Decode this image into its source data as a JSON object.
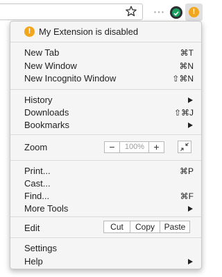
{
  "toolbar": {
    "bookmark_icon": "star-icon",
    "extension_icons": [
      "dots-icon",
      "green-check-extension-icon",
      "warning-extension-icon"
    ],
    "warning_glyph": "!"
  },
  "menu": {
    "warning": {
      "icon": "warning-icon",
      "glyph": "!",
      "label": "My Extension is disabled",
      "color": "#f2a61c"
    },
    "new_tab": {
      "label": "New Tab",
      "shortcut": "⌘T"
    },
    "new_window": {
      "label": "New Window",
      "shortcut": "⌘N"
    },
    "new_incognito": {
      "label": "New Incognito Window",
      "shortcut": "⇧⌘N"
    },
    "history": {
      "label": "History",
      "submenu": true
    },
    "downloads": {
      "label": "Downloads",
      "shortcut": "⇧⌘J"
    },
    "bookmarks": {
      "label": "Bookmarks",
      "submenu": true
    },
    "zoom": {
      "label": "Zoom",
      "minus": "−",
      "value": "100%",
      "plus": "+",
      "fullscreen_icon": "fullscreen-icon"
    },
    "print": {
      "label": "Print...",
      "shortcut": "⌘P"
    },
    "cast": {
      "label": "Cast..."
    },
    "find": {
      "label": "Find...",
      "shortcut": "⌘F"
    },
    "more_tools": {
      "label": "More Tools",
      "submenu": true
    },
    "edit": {
      "label": "Edit",
      "cut": "Cut",
      "copy": "Copy",
      "paste": "Paste"
    },
    "settings": {
      "label": "Settings"
    },
    "help": {
      "label": "Help",
      "submenu": true
    }
  }
}
